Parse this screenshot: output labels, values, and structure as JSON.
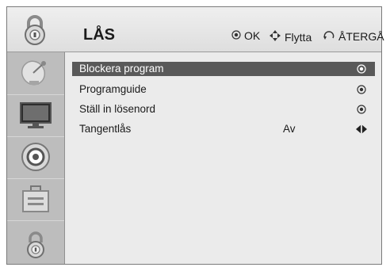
{
  "header": {
    "title": "LÅS",
    "ok_label": "OK",
    "move_label": "Flytta",
    "back_label": "ÅTERGÅ"
  },
  "menu": {
    "items": [
      {
        "label": "Blockera program",
        "value": "",
        "end_icon": "circle-dot-icon"
      },
      {
        "label": "Programguide",
        "value": "",
        "end_icon": "circle-dot-icon"
      },
      {
        "label": "Ställ in lösenord",
        "value": "",
        "end_icon": "circle-dot-icon"
      },
      {
        "label": "Tangentlås",
        "value": "Av",
        "end_icon": "left-right-arrows-icon"
      }
    ]
  },
  "sidebar": {
    "icons": [
      "lock-icon",
      "satellite-dish-icon",
      "tv-monitor-icon",
      "speaker-icon",
      "toolbox-icon",
      "lock-icon"
    ]
  },
  "colors": {
    "selected_row_bg": "#595959",
    "panel_bg": "#ebebeb",
    "sidebar_bg": "#bdbdbd"
  }
}
